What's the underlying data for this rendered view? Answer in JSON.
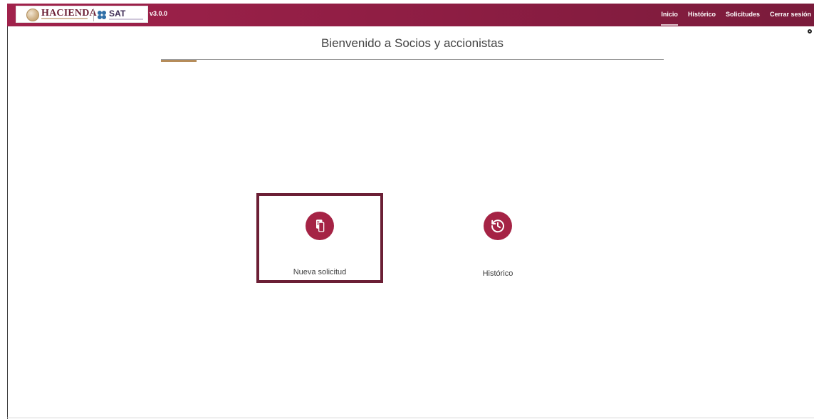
{
  "header": {
    "version": "v3.0.0",
    "nav": [
      {
        "label": "Inicio"
      },
      {
        "label": "Histórico"
      },
      {
        "label": "Solicitudes"
      },
      {
        "label": "Cerrar sesión"
      }
    ]
  },
  "brand": {
    "hacienda": "HACIENDA",
    "sat": "SAT"
  },
  "main": {
    "title": "Bienvenido a Socios y accionistas",
    "options": [
      {
        "label": "Nueva solicitud",
        "icon": "copy-icon"
      },
      {
        "label": "Histórico",
        "icon": "history-icon"
      }
    ]
  },
  "colors": {
    "primary": "#a52345",
    "header": "#8d1d43",
    "accent": "#b58c5a",
    "selected_border": "#6b1f35"
  }
}
